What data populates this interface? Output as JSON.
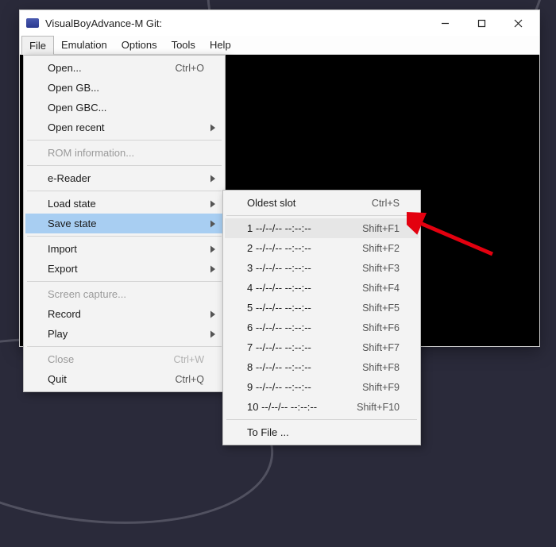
{
  "window": {
    "title": "VisualBoyAdvance-M Git:"
  },
  "menubar": {
    "items": [
      "File",
      "Emulation",
      "Options",
      "Tools",
      "Help"
    ],
    "active_index": 0
  },
  "file_menu": {
    "groups": [
      [
        {
          "label": "Open...",
          "accel": "Ctrl+O",
          "submenu": false,
          "disabled": false
        },
        {
          "label": "Open GB...",
          "accel": "",
          "submenu": false,
          "disabled": false
        },
        {
          "label": "Open GBC...",
          "accel": "",
          "submenu": false,
          "disabled": false
        },
        {
          "label": "Open recent",
          "accel": "",
          "submenu": true,
          "disabled": false
        }
      ],
      [
        {
          "label": "ROM information...",
          "accel": "",
          "submenu": false,
          "disabled": true
        }
      ],
      [
        {
          "label": "e-Reader",
          "accel": "",
          "submenu": true,
          "disabled": false
        }
      ],
      [
        {
          "label": "Load state",
          "accel": "",
          "submenu": true,
          "disabled": false
        },
        {
          "label": "Save state",
          "accel": "",
          "submenu": true,
          "disabled": false,
          "highlight": true
        }
      ],
      [
        {
          "label": "Import",
          "accel": "",
          "submenu": true,
          "disabled": false
        },
        {
          "label": "Export",
          "accel": "",
          "submenu": true,
          "disabled": false
        }
      ],
      [
        {
          "label": "Screen capture...",
          "accel": "",
          "submenu": false,
          "disabled": true
        },
        {
          "label": "Record",
          "accel": "",
          "submenu": true,
          "disabled": false
        },
        {
          "label": "Play",
          "accel": "",
          "submenu": true,
          "disabled": false
        }
      ],
      [
        {
          "label": "Close",
          "accel": "Ctrl+W",
          "submenu": false,
          "disabled": true
        },
        {
          "label": "Quit",
          "accel": "Ctrl+Q",
          "submenu": false,
          "disabled": false
        }
      ]
    ]
  },
  "save_submenu": {
    "head": {
      "label": "Oldest slot",
      "accel": "Ctrl+S"
    },
    "slots": [
      {
        "label": "1  --/--/-- --:--:--",
        "accel": "Shift+F1",
        "highlight": true
      },
      {
        "label": "2  --/--/-- --:--:--",
        "accel": "Shift+F2"
      },
      {
        "label": "3  --/--/-- --:--:--",
        "accel": "Shift+F3"
      },
      {
        "label": "4  --/--/-- --:--:--",
        "accel": "Shift+F4"
      },
      {
        "label": "5  --/--/-- --:--:--",
        "accel": "Shift+F5"
      },
      {
        "label": "6  --/--/-- --:--:--",
        "accel": "Shift+F6"
      },
      {
        "label": "7  --/--/-- --:--:--",
        "accel": "Shift+F7"
      },
      {
        "label": "8  --/--/-- --:--:--",
        "accel": "Shift+F8"
      },
      {
        "label": "9  --/--/-- --:--:--",
        "accel": "Shift+F9"
      },
      {
        "label": "10  --/--/-- --:--:--",
        "accel": "Shift+F10"
      }
    ],
    "tail": {
      "label": "To File ..."
    }
  },
  "annotation": {
    "arrow_color": "#e3000f"
  }
}
